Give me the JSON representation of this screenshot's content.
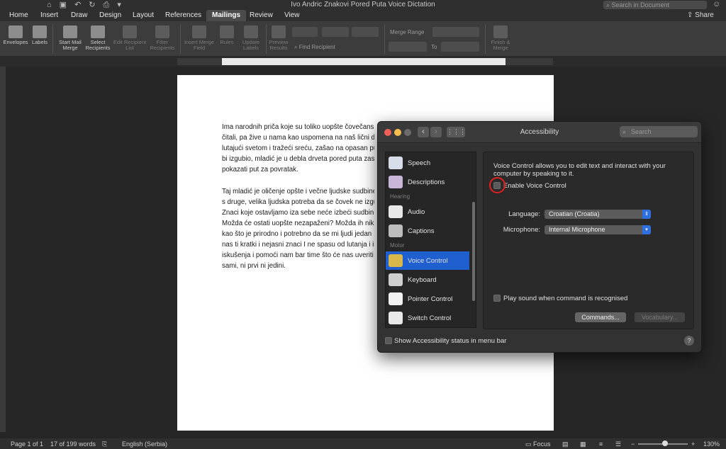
{
  "app": {
    "document_title": "Ivo Andric Znakovi Pored Puta Voice Dictation",
    "search_placeholder": "Search in Document",
    "share_label": "Share",
    "quick_access": [
      "home",
      "save",
      "undo",
      "redo",
      "print",
      "more"
    ]
  },
  "tabs": [
    {
      "label": "Home"
    },
    {
      "label": "Insert"
    },
    {
      "label": "Draw"
    },
    {
      "label": "Design"
    },
    {
      "label": "Layout"
    },
    {
      "label": "References"
    },
    {
      "label": "Mailings",
      "active": true
    },
    {
      "label": "Review"
    },
    {
      "label": "View"
    }
  ],
  "ribbon": {
    "envelopes": "Envelopes",
    "labels": "Labels",
    "start_mail_merge": "Start Mail Merge",
    "select_recipients": "Select Recipients",
    "edit_recipient_list": "Edit Recipient List",
    "filter_recipients": "Filter Recipients",
    "insert_merge_field": "Insert Merge Field",
    "rules": "Rules",
    "update_labels": "Update Labels",
    "preview_results": "Preview Results",
    "find_recipient": "Find Recipient",
    "merge_range": "Merge Range",
    "to": "To",
    "finish_merge": "Finish & Merge"
  },
  "document": {
    "paragraph1": [
      "Ima narodnih priča koje su toliko uopšte čovečans",
      "čitali, pa žive u nama kao uspomena na naš lični do",
      "lutajući svetom i tražeći sreću, zašao na opasan pu",
      "bi izgubio, mladić je u debla drveta pored puta zas",
      "pokazati put za povratak."
    ],
    "paragraph2": [
      "Taj mladić je oličenje opšte i večne ljudske sudbine",
      "s druge, velika ljudska potreba da se čovek ne izgu",
      "Znaci koje ostavljamo iza sebe neće izbeći sudbinu",
      "Možda će ostati uopšte nezapaženi? Možda ih nik",
      "kao što je prirodno i potrebno da se mi ljudi jedan",
      "nas ti kratki i nejasni znaci I ne spasu od lutanja i is",
      "iskušenja i pomoći nam bar time što će nas uveriti",
      "sami, ni prvi ni jedini."
    ]
  },
  "dialog": {
    "title": "Accessibility",
    "search_placeholder": "Search",
    "sidebar": {
      "items": [
        {
          "label": "Speech",
          "icon": "speech-icon"
        },
        {
          "label": "Descriptions",
          "icon": "descriptions-icon"
        },
        {
          "label": "Audio",
          "icon": "audio-icon"
        },
        {
          "label": "Captions",
          "icon": "captions-icon"
        },
        {
          "label": "Voice Control",
          "icon": "voice-control-icon",
          "selected": true
        },
        {
          "label": "Keyboard",
          "icon": "keyboard-icon"
        },
        {
          "label": "Pointer Control",
          "icon": "pointer-control-icon"
        },
        {
          "label": "Switch Control",
          "icon": "switch-control-icon"
        }
      ],
      "headings": {
        "hearing": "Hearing",
        "motor": "Motor"
      }
    },
    "voice_control": {
      "description": "Voice Control allows you to edit text and interact with your computer by speaking to it.",
      "enable_label": "Enable Voice Control",
      "enabled": false,
      "language_label": "Language:",
      "language_value": "Croatian (Croatia)",
      "microphone_label": "Microphone:",
      "microphone_value": "Internal Microphone",
      "play_sound_label": "Play sound when command is recognised",
      "play_sound": false,
      "commands_button": "Commands...",
      "vocabulary_button": "Vocabulary..."
    },
    "show_status_label": "Show Accessibility status in menu bar",
    "help": "?"
  },
  "statusbar": {
    "page": "Page 1 of 1",
    "words": "17 of 199 words",
    "language": "English (Serbia)",
    "focus": "Focus",
    "zoom": "130%",
    "minus": "−",
    "plus": "+"
  },
  "colors": {
    "selection": "#1f5fd0",
    "highlight_ring": "#e02020",
    "popup_arrow": "#2f6fe0"
  }
}
